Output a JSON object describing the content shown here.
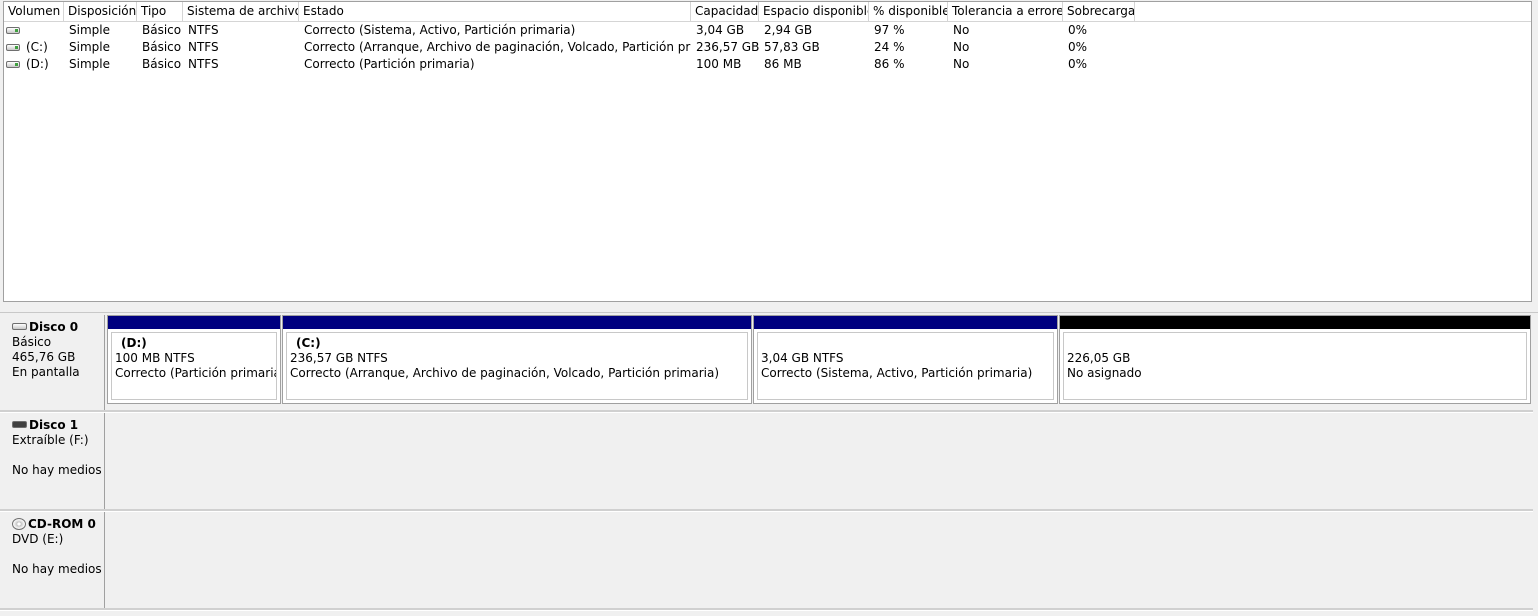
{
  "list": {
    "columns": [
      "Volumen",
      "Disposición",
      "Tipo",
      "Sistema de archivos",
      "Estado",
      "Capacidad",
      "Espacio disponible",
      "% disponible",
      "Tolerancia a errores",
      "Sobrecarga"
    ],
    "rows": [
      {
        "volume": "",
        "layout": "Simple",
        "type": "Básico",
        "fs": "NTFS",
        "status": "Correcto (Sistema, Activo, Partición primaria)",
        "capacity": "3,04 GB",
        "free": "2,94 GB",
        "pct": "97 %",
        "fault": "No",
        "overhead": "0%"
      },
      {
        "volume": "(C:)",
        "layout": "Simple",
        "type": "Básico",
        "fs": "NTFS",
        "status": "Correcto (Arranque, Archivo de paginación, Volcado, Partición primaria)",
        "capacity": "236,57 GB",
        "free": "57,83 GB",
        "pct": "24 %",
        "fault": "No",
        "overhead": "0%"
      },
      {
        "volume": "(D:)",
        "layout": "Simple",
        "type": "Básico",
        "fs": "NTFS",
        "status": "Correcto (Partición primaria)",
        "capacity": "100 MB",
        "free": "86 MB",
        "pct": "86 %",
        "fault": "No",
        "overhead": "0%"
      }
    ]
  },
  "disks": [
    {
      "name": "Disco 0",
      "line1": "Básico",
      "line2": "465,76 GB",
      "line3": "En pantalla",
      "icon": "hard-disk-icon",
      "partitions": [
        {
          "name": "(D:)",
          "size": "100 MB NTFS",
          "status": "Correcto (Partición primaria)",
          "bar_color": "#00007f"
        },
        {
          "name": "(C:)",
          "size": "236,57 GB NTFS",
          "status": "Correcto (Arranque, Archivo de paginación, Volcado, Partición primaria)",
          "bar_color": "#00007f"
        },
        {
          "name": "",
          "size": "3,04 GB NTFS",
          "status": "Correcto (Sistema, Activo, Partición primaria)",
          "bar_color": "#00007f"
        },
        {
          "name": "",
          "size": "226,05 GB",
          "status": "No asignado",
          "bar_color": "#000000"
        }
      ]
    },
    {
      "name": "Disco 1",
      "line1": "Extraíble (F:)",
      "line2": "",
      "line3": "No hay medios",
      "icon": "removable-disk-icon"
    },
    {
      "name": "CD-ROM 0",
      "line1": "DVD (E:)",
      "line2": "",
      "line3": "No hay medios",
      "icon": "cdrom-icon"
    }
  ]
}
